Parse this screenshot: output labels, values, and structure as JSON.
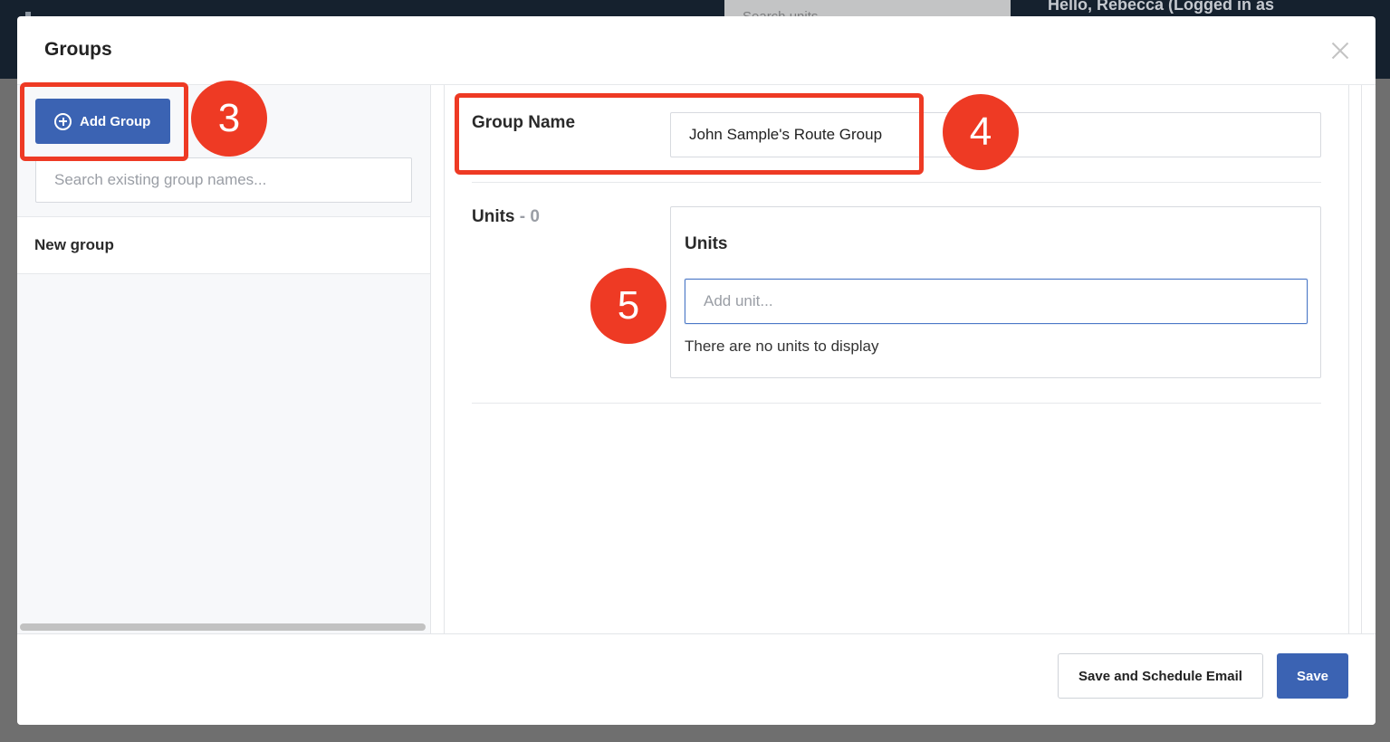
{
  "background": {
    "search_placeholder": "Search units...",
    "greeting": "Hello, Rebecca (Logged in as"
  },
  "modal": {
    "title": "Groups",
    "close_icon": "close-icon"
  },
  "left_panel": {
    "add_group_label": "Add Group",
    "add_group_icon": "plus-circle-icon",
    "search_placeholder": "Search existing group names...",
    "groups": [
      {
        "label": "New group"
      }
    ]
  },
  "right_panel": {
    "group_name_label": "Group Name",
    "group_name_value": "John Sample's Route Group",
    "units_label": "Units",
    "units_count": " - 0",
    "units_box_title": "Units",
    "add_unit_placeholder": "Add unit...",
    "empty_message": "There are no units to display"
  },
  "footer": {
    "save_schedule_label": "Save and Schedule Email",
    "save_label": "Save"
  },
  "annotations": {
    "step_3": "3",
    "step_4": "4",
    "step_5": "5",
    "highlight_color": "#ee3a24"
  },
  "colors": {
    "primary": "#3b63b3",
    "header_bg": "#15212e",
    "focus_border": "#4d79c7"
  }
}
